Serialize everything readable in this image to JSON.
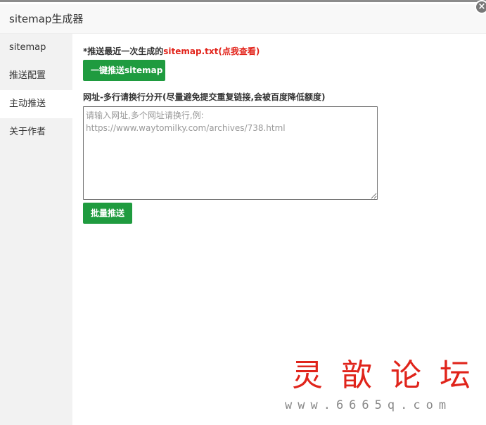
{
  "window": {
    "title": "sitemap生成器",
    "close_glyph": "×"
  },
  "sidebar": {
    "items": [
      {
        "label": "sitemap",
        "active": false
      },
      {
        "label": "推送配置",
        "active": false
      },
      {
        "label": "主动推送",
        "active": true
      },
      {
        "label": "关于作者",
        "active": false
      }
    ]
  },
  "main": {
    "notice_prefix": "*推送最近一次生成的",
    "notice_link": "sitemap.txt(点我查看)",
    "push_sitemap_button": "一键推送sitemap",
    "url_label": "网址-多行请换行分开(尽量避免提交重复链接,会被百度降低额度)",
    "url_placeholder": "请输入网址,多个网址请换行,例:\nhttps://www.waytomilky.com/archives/738.html",
    "url_value": "",
    "batch_push_button": "批量推送"
  },
  "watermark": {
    "title": "灵歆论坛",
    "url": "www.6665q.com"
  },
  "colors": {
    "accent_green": "#1f9b3f",
    "link_red": "#e2231a",
    "sidebar_bg": "#f2f2f2",
    "watermark_red": "#e0241b"
  }
}
